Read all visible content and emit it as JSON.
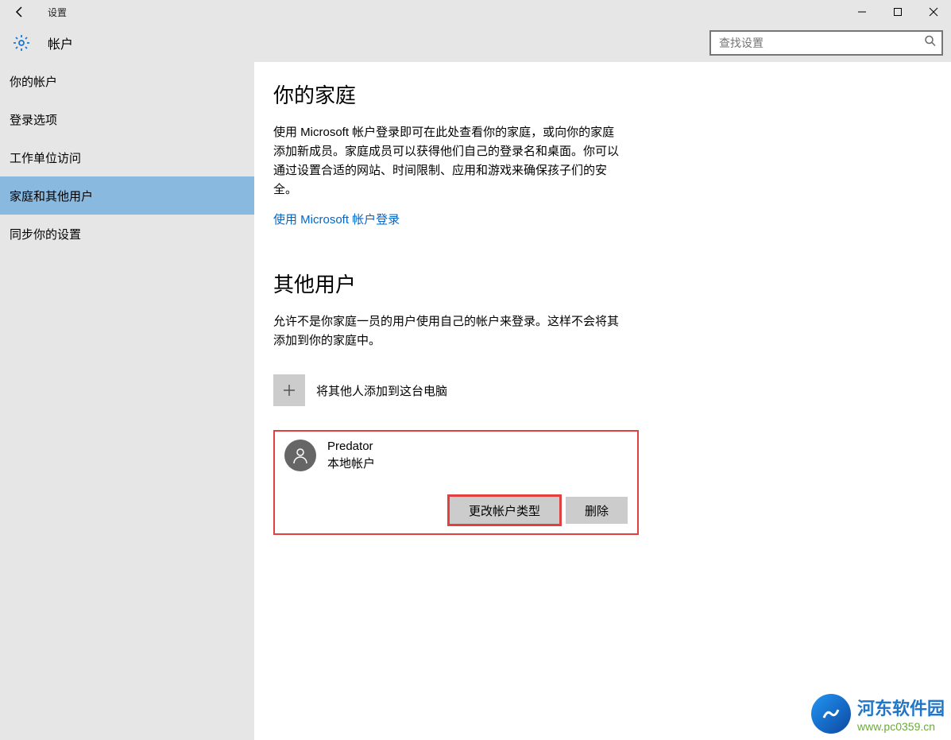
{
  "titlebar": {
    "title": "设置"
  },
  "header": {
    "title": "帐户",
    "search_placeholder": "查找设置"
  },
  "sidebar": {
    "items": [
      {
        "label": "你的帐户"
      },
      {
        "label": "登录选项"
      },
      {
        "label": "工作单位访问"
      },
      {
        "label": "家庭和其他用户"
      },
      {
        "label": "同步你的设置"
      }
    ],
    "active_index": 3
  },
  "main": {
    "family": {
      "title": "你的家庭",
      "description": "使用 Microsoft 帐户登录即可在此处查看你的家庭，或向你的家庭添加新成员。家庭成员可以获得他们自己的登录名和桌面。你可以通过设置合适的网站、时间限制、应用和游戏来确保孩子们的安全。",
      "link": "使用 Microsoft 帐户登录"
    },
    "other_users": {
      "title": "其他用户",
      "description": "允许不是你家庭一员的用户使用自己的帐户来登录。这样不会将其添加到你的家庭中。",
      "add_label": "将其他人添加到这台电脑",
      "user": {
        "name": "Predator",
        "type": "本地帐户",
        "change_type_label": "更改帐户类型",
        "remove_label": "删除"
      }
    }
  },
  "watermark": {
    "line1": "河东软件园",
    "line2": "www.pc0359.cn"
  }
}
